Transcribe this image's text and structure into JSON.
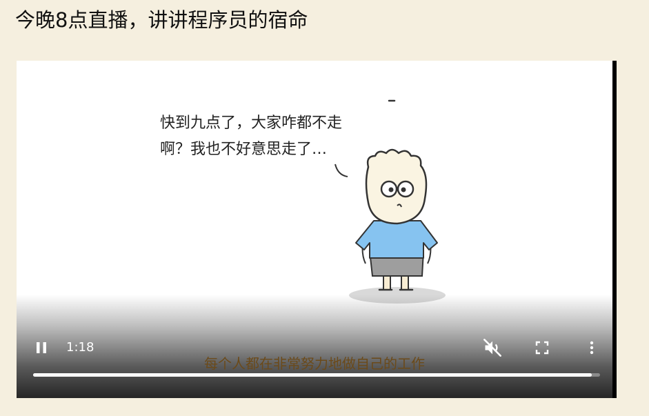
{
  "page": {
    "title": "今晚8点直播，讲讲程序员的宿命"
  },
  "video": {
    "speech_line_1": "快到九点了，大家咋都不走",
    "speech_line_2": "啊？我也不好意思走了…",
    "subtitle": "每个人都在非常努力地做自己的工作",
    "current_time": "1:18",
    "progress": 0.985,
    "state": "playing",
    "muted": true
  },
  "icons": {
    "play_pause": "pause-icon",
    "mute": "volume-muted-icon",
    "fullscreen": "fullscreen-icon",
    "more": "more-vert-icon"
  },
  "colors": {
    "page_background": "#f5efdf",
    "subtitle": "#6b4a1a",
    "shirt": "#86c3f0",
    "shorts": "#9e9e9e"
  }
}
